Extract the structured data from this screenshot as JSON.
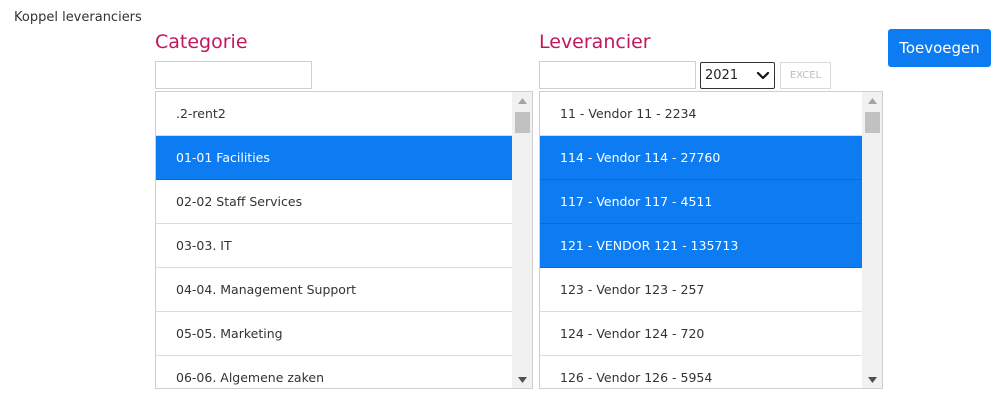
{
  "page_title": "Koppel leveranciers",
  "categorie": {
    "heading": "Categorie",
    "filter_value": "",
    "items": [
      {
        "label": ".2-rent2",
        "selected": false
      },
      {
        "label": "01-01 Facilities",
        "selected": true
      },
      {
        "label": "02-02 Staff Services",
        "selected": false
      },
      {
        "label": "03-03. IT",
        "selected": false
      },
      {
        "label": "04-04. Management Support",
        "selected": false
      },
      {
        "label": "05-05. Marketing",
        "selected": false
      },
      {
        "label": "06-06. Algemene zaken",
        "selected": false
      }
    ]
  },
  "leverancier": {
    "heading": "Leverancier",
    "filter_value": "",
    "year_selected": "2021",
    "excel_label": "EXCEL",
    "items": [
      {
        "label": "11 - Vendor 11 - 2234",
        "selected": false
      },
      {
        "label": "114 - Vendor 114 - 27760",
        "selected": true
      },
      {
        "label": "117 - Vendor 117 - 4511",
        "selected": true
      },
      {
        "label": "121 - VENDOR 121 - 135713",
        "selected": true
      },
      {
        "label": "123 - Vendor 123 - 257",
        "selected": false
      },
      {
        "label": "124 - Vendor 124 - 720",
        "selected": false
      },
      {
        "label": "126 - Vendor 126 - 5954",
        "selected": false
      }
    ]
  },
  "add_button_label": "Toevoegen",
  "colors": {
    "accent": "#0d7cf2",
    "heading": "#c2185b"
  }
}
